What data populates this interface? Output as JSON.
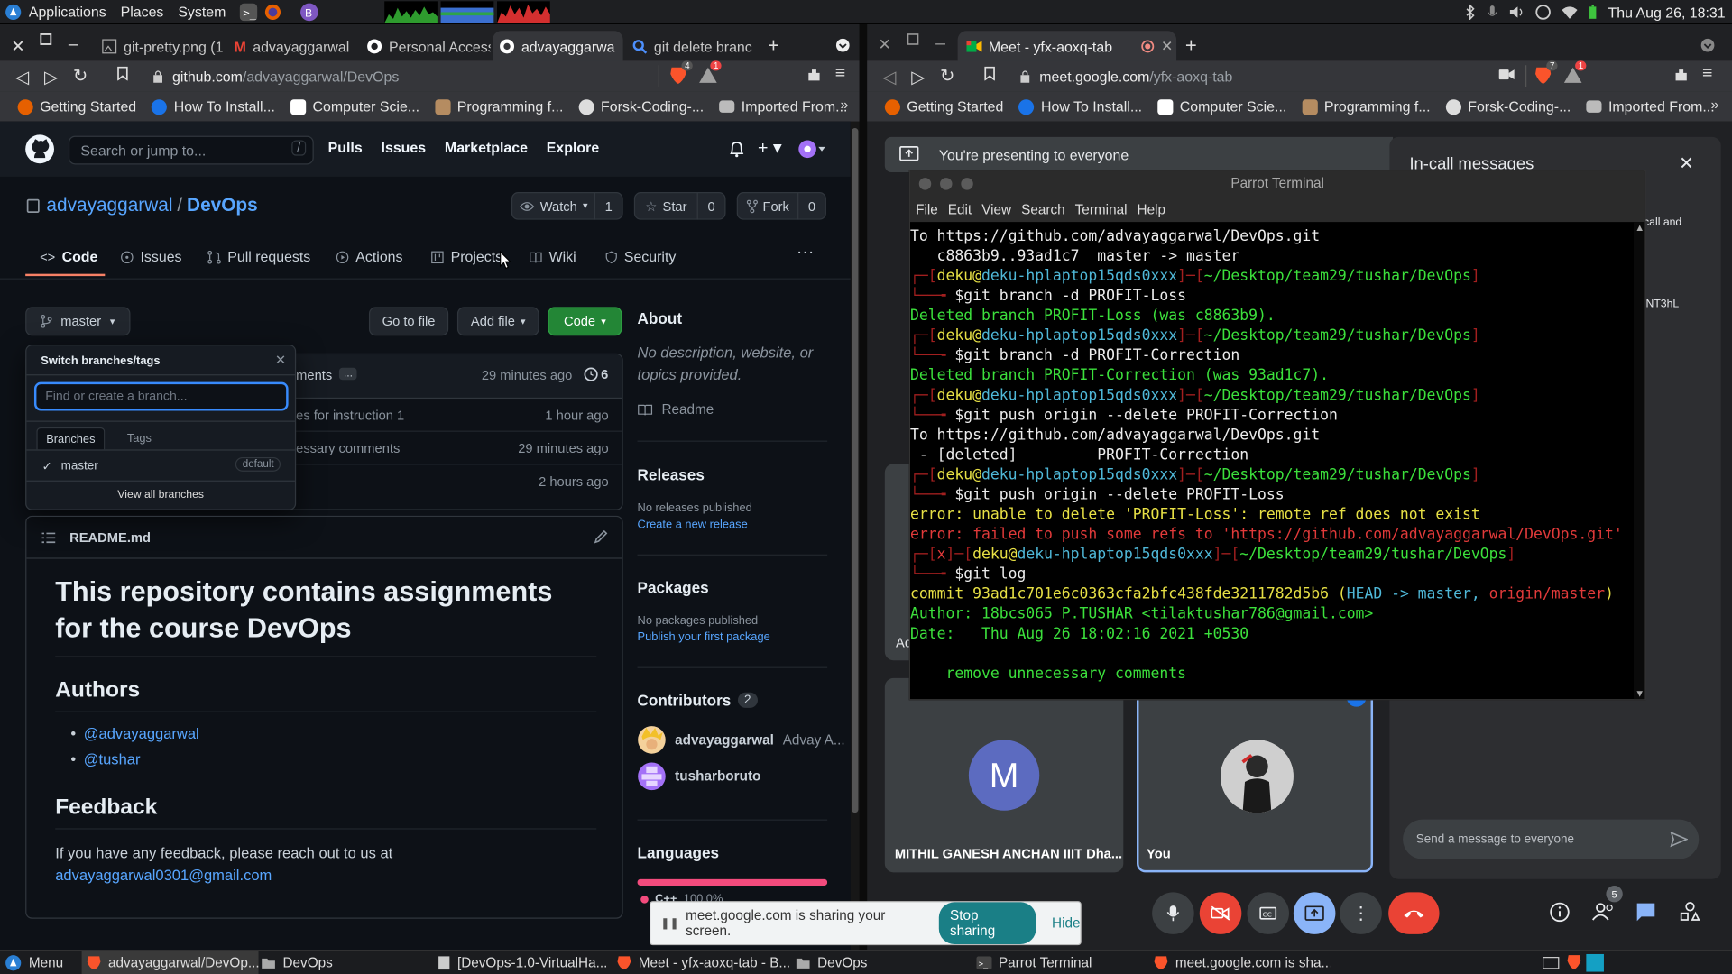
{
  "top_panel": {
    "menus": [
      "Applications",
      "Places",
      "System"
    ],
    "clock": "Thu Aug 26, 18:31"
  },
  "left_browser": {
    "tabs": [
      {
        "label": "git-pretty.png (1"
      },
      {
        "label": "advayaggarwal"
      },
      {
        "label": "Personal Access"
      },
      {
        "label": "advayaggarwa"
      },
      {
        "label": "git delete branc"
      }
    ],
    "url_host": "github.com",
    "url_path": "/advayaggarwal/DevOps",
    "badges": {
      "brave": "4",
      "rewards": "1"
    },
    "bookmarks": [
      "Getting Started",
      "How To Install...",
      "Computer Scie...",
      "Programming f...",
      "Forsk-Coding-...",
      "Imported From..."
    ]
  },
  "github": {
    "search_placeholder": "Search or jump to...",
    "slash_key": "/",
    "nav": [
      "Pulls",
      "Issues",
      "Marketplace",
      "Explore"
    ],
    "owner": "advayaggarwal",
    "slash": "/",
    "repo": "DevOps",
    "watch_label": "Watch",
    "watch_count": "1",
    "star_label": "Star",
    "star_count": "0",
    "fork_label": "Fork",
    "fork_count": "0",
    "tabs": [
      "Code",
      "Issues",
      "Pull requests",
      "Actions",
      "Projects",
      "Wiki",
      "Security"
    ],
    "more": "···",
    "branch": "master",
    "go_to_file": "Go to file",
    "add_file": "Add file",
    "code_button": "Code",
    "commit_msg_partial": "ments",
    "ellipsis": "...",
    "commit_time": "29 minutes ago",
    "commit_count": "6",
    "files": [
      {
        "msg": "es for instruction 1",
        "time": "1 hour ago"
      },
      {
        "msg": "essary comments",
        "time": "29 minutes ago"
      },
      {
        "msg": "",
        "time": "2 hours ago"
      }
    ],
    "dropdown": {
      "title": "Switch branches/tags",
      "placeholder": "Find or create a branch...",
      "tab_branches": "Branches",
      "tab_tags": "Tags",
      "branch": "master",
      "default_label": "default",
      "view_all": "View all branches"
    },
    "readme": {
      "filename": "README.md",
      "h1": "This repository contains assignments for the course DevOps",
      "h2_authors": "Authors",
      "authors": [
        "@advayaggarwal",
        "@tushar"
      ],
      "h2_feedback": "Feedback",
      "feedback_text": "If you have any feedback, please reach out to us at",
      "email": "advayaggarwal0301@gmail.com"
    },
    "about": {
      "title": "About",
      "desc": "No description, website, or topics provided.",
      "readme": "Readme"
    },
    "releases": {
      "title": "Releases",
      "none": "No releases published",
      "link": "Create a new release"
    },
    "packages": {
      "title": "Packages",
      "none": "No packages published",
      "link": "Publish your first package"
    },
    "contributors": {
      "title": "Contributors",
      "count": "2",
      "list": [
        {
          "login": "advayaggarwal",
          "name": "Advay A..."
        },
        {
          "login": "tusharboruto",
          "name": ""
        }
      ]
    },
    "languages": {
      "title": "Languages",
      "items": [
        {
          "name": "C++",
          "percent": "100.0%"
        }
      ]
    }
  },
  "right_browser": {
    "tab_label": "Meet - yfx-aoxq-tab",
    "url_host": "meet.google.com",
    "url_path": "/yfx-aoxq-tab",
    "badges": {
      "brave": "7",
      "rewards": "1"
    },
    "bookmarks": [
      "Getting Started",
      "How To Install...",
      "Computer Scie...",
      "Programming f...",
      "Forsk-Coding-...",
      "Imported From..."
    ]
  },
  "meet": {
    "presenting": "You're presenting to everyone",
    "panel_title": "In-call messages",
    "panel_frag_1": "call and",
    "panel_frag_2": "NT3hL",
    "participants": [
      {
        "initial": "M",
        "name": "MITHIL GANESH ANCHAN IIIT Dha...",
        "color": "#5c6bc0"
      },
      {
        "initial": "",
        "name": "You",
        "color": ""
      }
    ],
    "behind_name": "Ac",
    "message_placeholder": "Send a message to everyone",
    "people_count": "5"
  },
  "terminal": {
    "title": "Parrot Terminal",
    "menu": [
      "File",
      "Edit",
      "View",
      "Search",
      "Terminal",
      "Help"
    ],
    "user": "deku",
    "host": "deku-hplaptop15qds0xxx",
    "path": "~/Desktop/team29/tushar/DevOps",
    "lines": [
      "To https://github.com/advayaggarwal/DevOps.git",
      "   c8863b9..93ad1c7  master -> master",
      "$git branch -d PROFIT-Loss",
      "Deleted branch PROFIT-Loss (was c8863b9).",
      "$git branch -d PROFIT-Correction",
      "Deleted branch PROFIT-Correction (was 93ad1c7).",
      "$git push origin --delete PROFIT-Correction",
      "To https://github.com/advayaggarwal/DevOps.git",
      " - [deleted]         PROFIT-Correction",
      "$git push origin --delete PROFIT-Loss",
      "error: unable to delete 'PROFIT-Loss': remote ref does not exist",
      "error: failed to push some refs to 'https://github.com/advayaggarwal/DevOps.git'",
      "x",
      "$git log",
      "commit 93ad1c701e6c0363cfa2bfc438fde3211782d5b6",
      "HEAD -> master, ",
      "origin/master",
      "Author: 18bcs065 P.TUSHAR <tilaktushar786@gmail.com>",
      "Date:   Thu Aug 26 18:02:16 2021 +0530",
      "    remove unnecessary comments"
    ]
  },
  "share_bar": {
    "text": "meet.google.com is sharing your screen.",
    "stop": "Stop sharing",
    "hide": "Hide"
  },
  "taskbar": {
    "menu": "Menu",
    "items": [
      "advayaggarwal/DevOp...",
      "DevOps",
      "[DevOps-1.0-VirtualHa...",
      "Meet - yfx-aoxq-tab - B...",
      "DevOps",
      "Parrot Terminal",
      "meet.google.com is sha..."
    ]
  },
  "colors": {
    "gh_bg": "#0d1117",
    "gh_link": "#58a6ff",
    "gh_green": "#238636",
    "meet_bg": "#202124",
    "meet_red": "#ea4335",
    "meet_blue": "#8ab4f8",
    "term_green": "#3ce03c",
    "term_red": "#e23a3a"
  }
}
